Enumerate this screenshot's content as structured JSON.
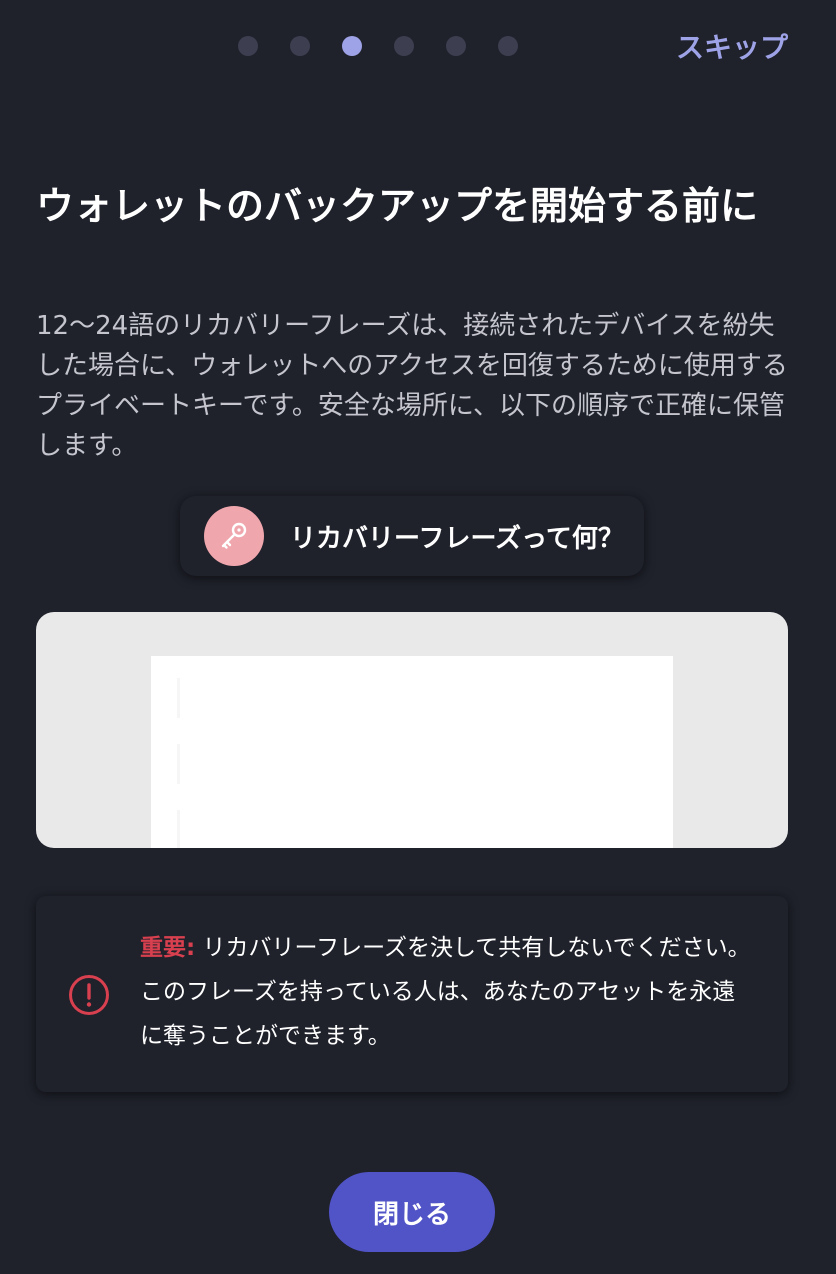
{
  "header": {
    "progress": {
      "total_steps": 6,
      "current_step": 3
    },
    "skip_label": "スキップ"
  },
  "title": "ウォレットのバックアップを開始する前に",
  "description": "12〜24語のリカバリーフレーズは、接続されたデバイスを紛失した場合に、ウォレットへのアクセスを回復するために使用するプライベートキーです。安全な場所に、以下の順序で正確に保管します。",
  "recovery_link": {
    "icon": "key-icon",
    "label": "リカバリーフレーズって何？"
  },
  "warning": {
    "icon": "alert-circle-icon",
    "prefix": "重要:",
    "text": " リカバリーフレーズを決して共有しないでください。このフレーズを持っている人は、あなたのアセットを永遠に奪うことができます。"
  },
  "close_label": "閉じる",
  "colors": {
    "background": "#1f212b",
    "accent": "#9ea2e6",
    "button": "#5154c7",
    "danger": "#d8404f",
    "key_badge": "#f0a6ad"
  }
}
